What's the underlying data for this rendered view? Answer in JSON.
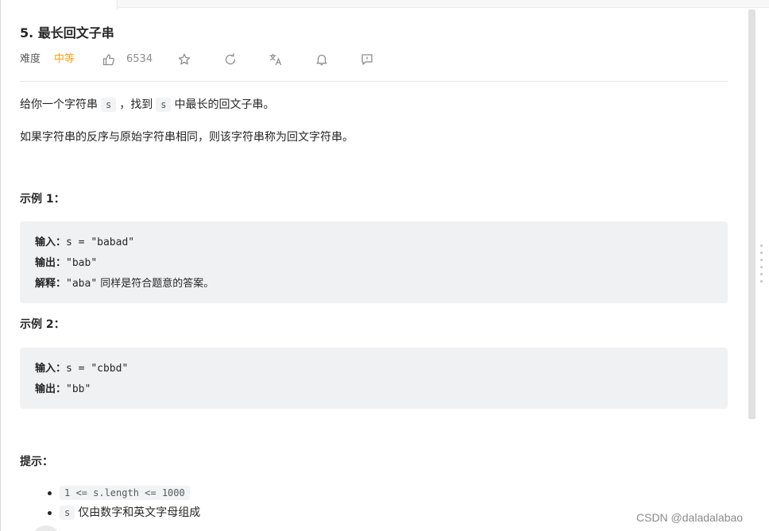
{
  "problem": {
    "title": "5. 最长回文子串",
    "difficulty_label": "难度",
    "difficulty_value": "中等",
    "likes": "6534"
  },
  "icons": [
    "thumbs-up-icon",
    "star-icon",
    "refresh-icon",
    "translate-icon",
    "bell-icon",
    "feedback-icon"
  ],
  "description": {
    "p1_before": "给你一个字符串",
    "p1_code1": "s",
    "p1_mid": "，找到",
    "p1_code2": "s",
    "p1_after": "中最长的回文子串。",
    "p2": "如果字符串的反序与原始字符串相同，则该字符串称为回文字符串。"
  },
  "examples": [
    {
      "heading": "示例 1：",
      "input_label": "输入：",
      "input_value": "s = \"babad\"",
      "output_label": "输出：",
      "output_value": "\"bab\"",
      "explain_label": "解释：",
      "explain_value": "\"aba\"",
      "explain_text": " 同样是符合题意的答案。"
    },
    {
      "heading": "示例 2：",
      "input_label": "输入：",
      "input_value": "s = \"cbbd\"",
      "output_label": "输出：",
      "output_value": "\"bb\""
    }
  ],
  "tips": {
    "heading": "提示：",
    "item1_code": "1 <= s.length <= 1000",
    "item2_code": "s",
    "item2_text": "仅由数字和英文字母组成"
  },
  "watermark": "CSDN @daladalabao",
  "colors": {
    "difficulty_medium": "#ff9f1a",
    "code_bg": "#f0f1f3"
  }
}
